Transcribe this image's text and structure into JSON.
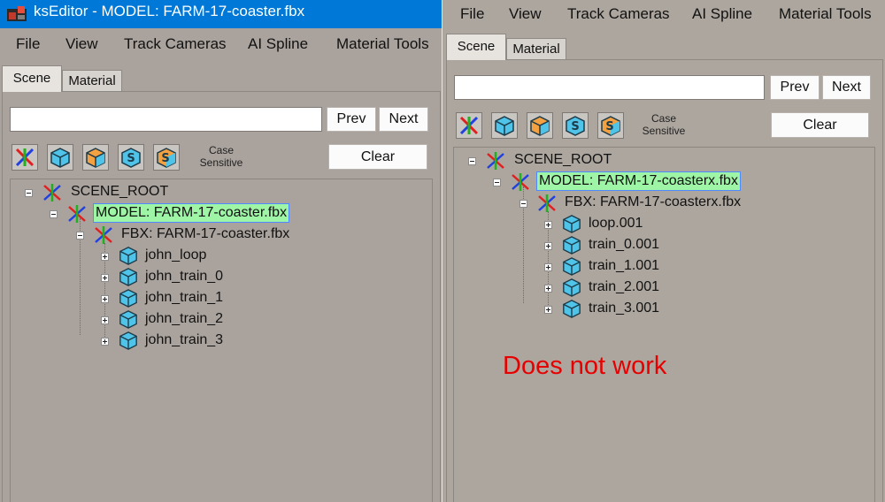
{
  "colors": {
    "titlebar": "#0078d7",
    "panel_bg": "#aaa39d",
    "selected_bg": "#9ef5a6",
    "annotation_red": "#e60000"
  },
  "left": {
    "window_title": "ksEditor - MODEL: FARM-17-coaster.fbx",
    "menu": [
      "File",
      "View",
      "Track Cameras",
      "AI Spline",
      "Material Tools"
    ],
    "tabs": [
      "Scene",
      "Material"
    ],
    "search": {
      "value": "",
      "placeholder": ""
    },
    "prev_label": "Prev",
    "next_label": "Next",
    "clear_label": "Clear",
    "case_label": [
      "Case",
      "Sensitive"
    ],
    "tree": {
      "root": "SCENE_ROOT",
      "model": "MODEL: FARM-17-coaster.fbx",
      "fbx": "FBX: FARM-17-coaster.fbx",
      "children": [
        "john_loop",
        "john_train_0",
        "john_train_1",
        "john_train_2",
        "john_train_3"
      ]
    }
  },
  "right": {
    "menu": [
      "File",
      "View",
      "Track Cameras",
      "AI Spline",
      "Material Tools"
    ],
    "tabs": [
      "Scene",
      "Material"
    ],
    "search": {
      "value": "",
      "placeholder": ""
    },
    "prev_label": "Prev",
    "next_label": "Next",
    "clear_label": "Clear",
    "case_label": [
      "Case",
      "Sensitive"
    ],
    "tree": {
      "root": "SCENE_ROOT",
      "model": "MODEL: FARM-17-coasterx.fbx",
      "fbx": "FBX: FARM-17-coasterx.fbx",
      "children": [
        "loop.001",
        "train_0.001",
        "train_1.001",
        "train_2.001",
        "train_3.001"
      ]
    }
  },
  "annotation": "Does not work",
  "tool_icons": [
    "axes-icon",
    "cube-blue-icon",
    "cube-orange-icon",
    "cube-blue-s-icon",
    "cube-orange-s-icon"
  ]
}
